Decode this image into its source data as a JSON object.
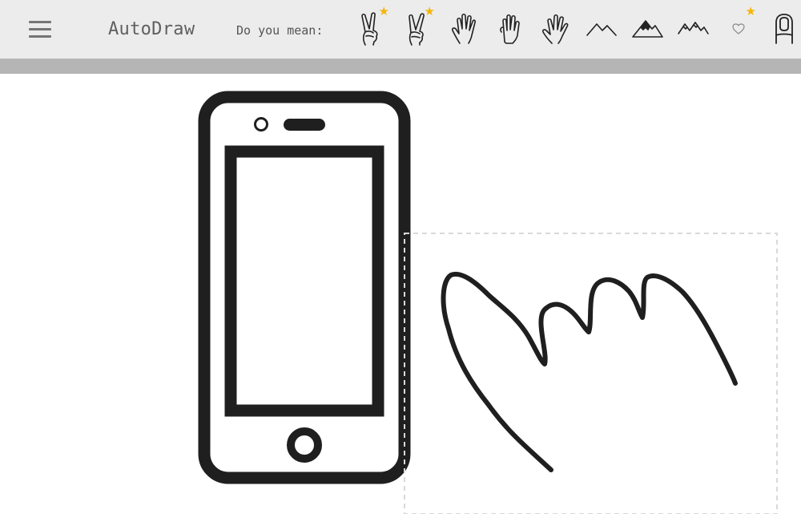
{
  "app": {
    "title": "AutoDraw"
  },
  "suggestions": {
    "label": "Do you mean:",
    "items": [
      {
        "name": "peace-sign-1",
        "starred": true
      },
      {
        "name": "peace-sign-2",
        "starred": true
      },
      {
        "name": "open-hand-1",
        "starred": false
      },
      {
        "name": "raised-hand",
        "starred": false
      },
      {
        "name": "open-hand-2",
        "starred": false
      },
      {
        "name": "mountain-1",
        "starred": false
      },
      {
        "name": "mountain-snow",
        "starred": false
      },
      {
        "name": "mountain-range",
        "starred": false
      },
      {
        "name": "heart",
        "starred": true
      },
      {
        "name": "fingertip",
        "starred": false
      }
    ],
    "star_glyph": "★",
    "star_color": "#f5b50a"
  },
  "colors": {
    "toolbar": "#ececec",
    "toolbar_shadow": "#b5b5b5",
    "ink": "#1f1f1f"
  }
}
